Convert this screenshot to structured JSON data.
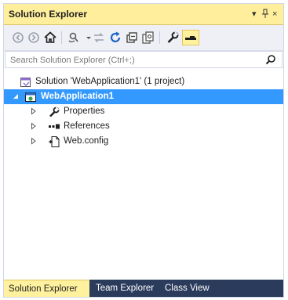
{
  "window": {
    "title": "Solution Explorer",
    "title_buttons": {
      "dropdown": "▾",
      "pin": "ᵖ",
      "close": "×"
    }
  },
  "toolbar": {
    "items": [
      "back-icon",
      "forward-icon",
      "home-icon",
      "pending-changes-filter-icon",
      "dropdown-arrow",
      "sync-with-active-document-icon",
      "refresh-icon",
      "collapse-all-icon",
      "show-all-files-icon",
      "properties-icon",
      "preview-selected-items-icon"
    ]
  },
  "search": {
    "placeholder": "Search Solution Explorer (Ctrl+;)"
  },
  "tree": {
    "solution": "Solution 'WebApplication1' (1 project)",
    "project": "WebApplication1",
    "children": [
      {
        "label": "Properties",
        "icon": "wrench-icon"
      },
      {
        "label": "References",
        "icon": "references-icon"
      },
      {
        "label": "Web.config",
        "icon": "config-file-icon"
      }
    ]
  },
  "tabs": [
    {
      "label": "Solution Explorer",
      "active": true
    },
    {
      "label": "Team Explorer",
      "active": false
    },
    {
      "label": "Class View",
      "active": false
    }
  ],
  "colors": {
    "title_bar": "#ffef9c",
    "selection": "#3399ff",
    "tab_strip": "#2b3b5c",
    "active_tab": "#fff19e"
  }
}
